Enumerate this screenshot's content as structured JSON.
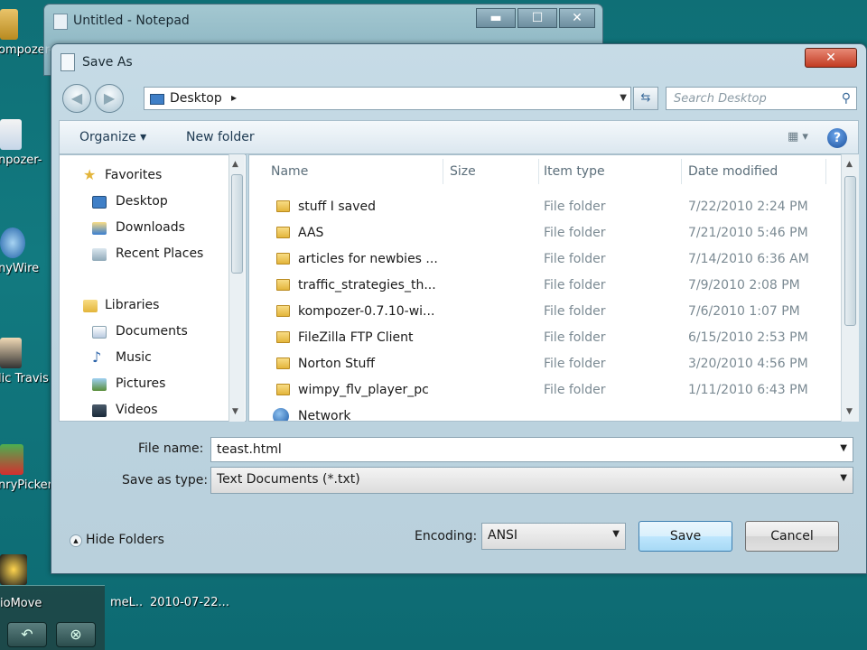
{
  "desktop": {
    "icons": [
      {
        "label": "ompozer-"
      },
      {
        "label": "npozer-"
      },
      {
        "label": "nyWire"
      },
      {
        "label": "lic Travis"
      },
      {
        "label": "nryPicker"
      },
      {
        "label": "ioMove"
      }
    ],
    "bottom_labels": [
      "meL..",
      "2010-07-22..."
    ]
  },
  "notepad": {
    "title": "Untitled - Notepad",
    "minimize": "▬",
    "maximize": "☐",
    "close": "✕"
  },
  "dialog": {
    "title": "Save As",
    "close": "✕",
    "address": {
      "location": "Desktop",
      "separator": "▸"
    },
    "search_placeholder": "Search Desktop",
    "toolbar": {
      "organize": "Organize ▾",
      "new_folder": "New folder",
      "view": "▦ ▾",
      "help": "?"
    },
    "nav": {
      "favorites": "Favorites",
      "desktop": "Desktop",
      "downloads": "Downloads",
      "recent": "Recent Places",
      "libraries": "Libraries",
      "documents": "Documents",
      "music": "Music",
      "pictures": "Pictures",
      "videos": "Videos"
    },
    "columns": {
      "name": "Name",
      "size": "Size",
      "type": "Item type",
      "date": "Date modified"
    },
    "files": [
      {
        "name": "stuff I saved",
        "type": "File folder",
        "date": "7/22/2010 2:24 PM"
      },
      {
        "name": "AAS",
        "type": "File folder",
        "date": "7/21/2010 5:46 PM"
      },
      {
        "name": "articles for newbies ...",
        "type": "File folder",
        "date": "7/14/2010 6:36 AM"
      },
      {
        "name": "traffic_strategies_th...",
        "type": "File folder",
        "date": "7/9/2010 2:08 PM"
      },
      {
        "name": "kompozer-0.7.10-wi...",
        "type": "File folder",
        "date": "7/6/2010 1:07 PM"
      },
      {
        "name": "FileZilla FTP Client",
        "type": "File folder",
        "date": "6/15/2010 2:53 PM"
      },
      {
        "name": "Norton Stuff",
        "type": "File folder",
        "date": "3/20/2010 4:56 PM"
      },
      {
        "name": "wimpy_flv_player_pc",
        "type": "File folder",
        "date": "1/11/2010 6:43 PM"
      }
    ],
    "network": "Network",
    "file_name_label": "File name:",
    "file_name_value": "teast.html",
    "save_type_label": "Save as type:",
    "save_type_value": "Text Documents (*.txt)",
    "hide_folders": "Hide Folders",
    "encoding_label": "Encoding:",
    "encoding_value": "ANSI",
    "save": "Save",
    "cancel": "Cancel"
  }
}
